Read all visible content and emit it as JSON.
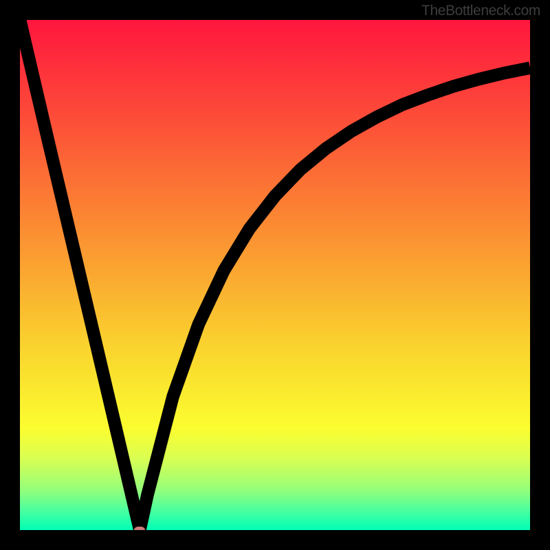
{
  "watermark": "TheBottleneck.com",
  "chart_data": {
    "type": "line",
    "title": "",
    "xlabel": "",
    "ylabel": "",
    "xlim": [
      0,
      100
    ],
    "ylim": [
      0,
      100
    ],
    "x": [
      0,
      5,
      10,
      15,
      20,
      23.5,
      25,
      30,
      35,
      40,
      45,
      50,
      55,
      60,
      65,
      70,
      75,
      80,
      85,
      90,
      95,
      100
    ],
    "values": [
      100,
      78.6,
      57.4,
      36.2,
      14.9,
      0,
      6.9,
      26.2,
      40.3,
      50.9,
      59.1,
      65.5,
      70.7,
      74.8,
      78.2,
      81.0,
      83.4,
      85.3,
      87.0,
      88.4,
      89.6,
      90.6
    ],
    "marker": {
      "x": 23.5,
      "y": 0
    },
    "gradient_stops": [
      {
        "offset": 0,
        "color": "#fe163e"
      },
      {
        "offset": 0.2,
        "color": "#fd4f38"
      },
      {
        "offset": 0.42,
        "color": "#fb9032"
      },
      {
        "offset": 0.63,
        "color": "#fad02e"
      },
      {
        "offset": 0.8,
        "color": "#fbfd2f"
      },
      {
        "offset": 0.86,
        "color": "#d9fe52"
      },
      {
        "offset": 0.92,
        "color": "#96ff7a"
      },
      {
        "offset": 0.96,
        "color": "#4dff9e"
      },
      {
        "offset": 1.0,
        "color": "#00ffb5"
      }
    ]
  }
}
